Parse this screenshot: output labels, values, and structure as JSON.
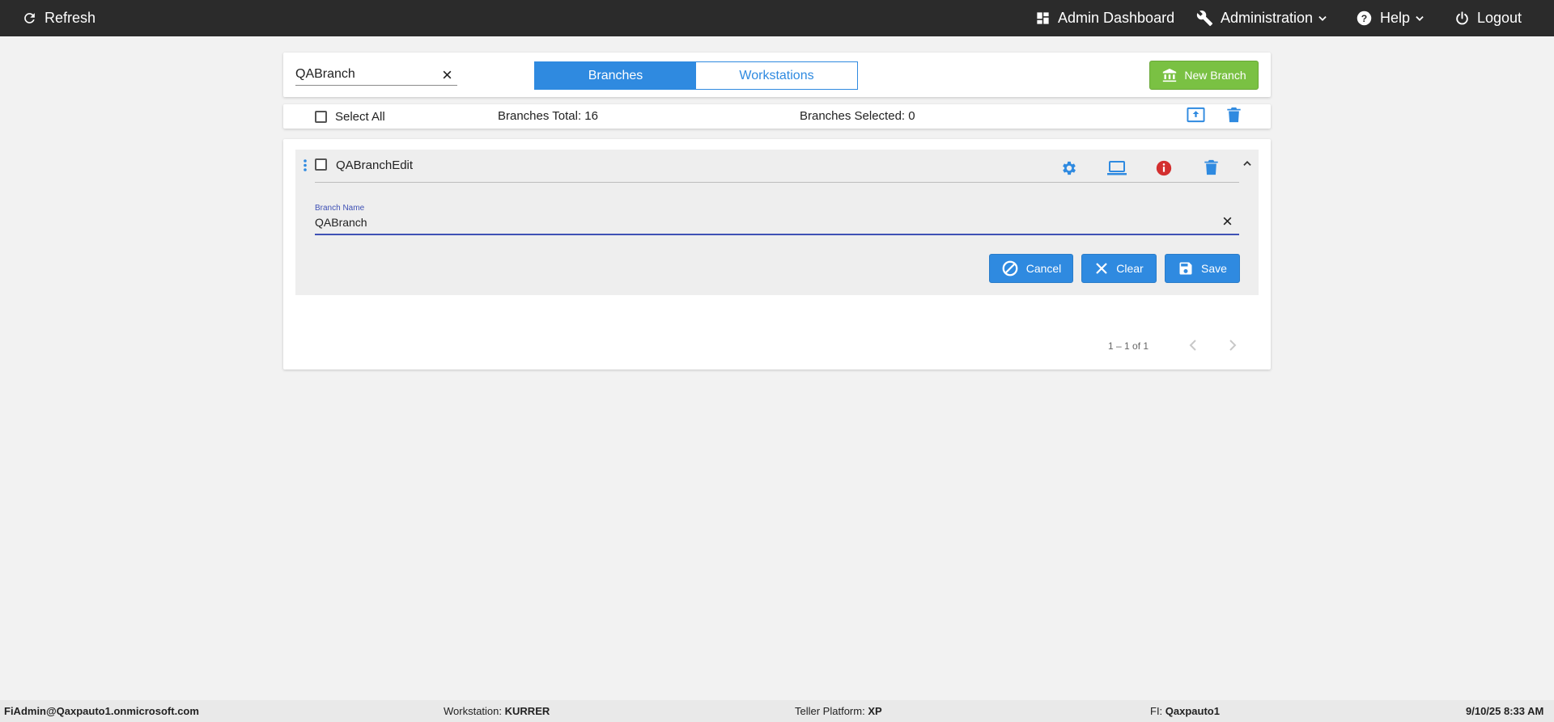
{
  "topbar": {
    "refresh": "Refresh",
    "admin_dashboard": "Admin Dashboard",
    "administration": "Administration",
    "help": "Help",
    "logout": "Logout"
  },
  "toolbar": {
    "search_value": "QABranch",
    "tabs": [
      {
        "label": "Branches",
        "active": true
      },
      {
        "label": "Workstations",
        "active": false
      }
    ],
    "new_branch": "New Branch"
  },
  "selection": {
    "select_all": "Select All",
    "total_label": "Branches Total:",
    "total_value": "16",
    "selected_label": "Branches Selected:",
    "selected_value": "0"
  },
  "item": {
    "title": "QABranchEdit",
    "field_label": "Branch Name",
    "field_value": "QABranch",
    "buttons": {
      "cancel": "Cancel",
      "clear": "Clear",
      "save": "Save"
    }
  },
  "pagination": {
    "range": "1 – 1 of 1"
  },
  "footer": {
    "user": "FiAdmin@Qaxpauto1.onmicrosoft.com",
    "workstation_label": "Workstation:",
    "workstation_value": "KURRER",
    "platform_label": "Teller Platform:",
    "platform_value": "XP",
    "fi_label": "FI:",
    "fi_value": "Qaxpauto1",
    "datetime": "9/10/25 8:33 AM"
  },
  "colors": {
    "accent": "#2f8ae0",
    "success": "#7ac143",
    "danger": "#d32f2f",
    "topbar": "#2b2b2b",
    "input_focus": "#3f51b5"
  },
  "icons": {
    "refresh": "refresh-icon",
    "dashboard": "dashboard-icon",
    "administration": "wrench-icon",
    "help": "help-icon",
    "logout": "power-icon",
    "new_branch": "bank-icon",
    "export": "upload-icon",
    "delete": "trash-icon",
    "settings": "gear-icon",
    "workstation": "laptop-icon",
    "info": "info-icon",
    "collapse": "chevron-up-icon"
  }
}
